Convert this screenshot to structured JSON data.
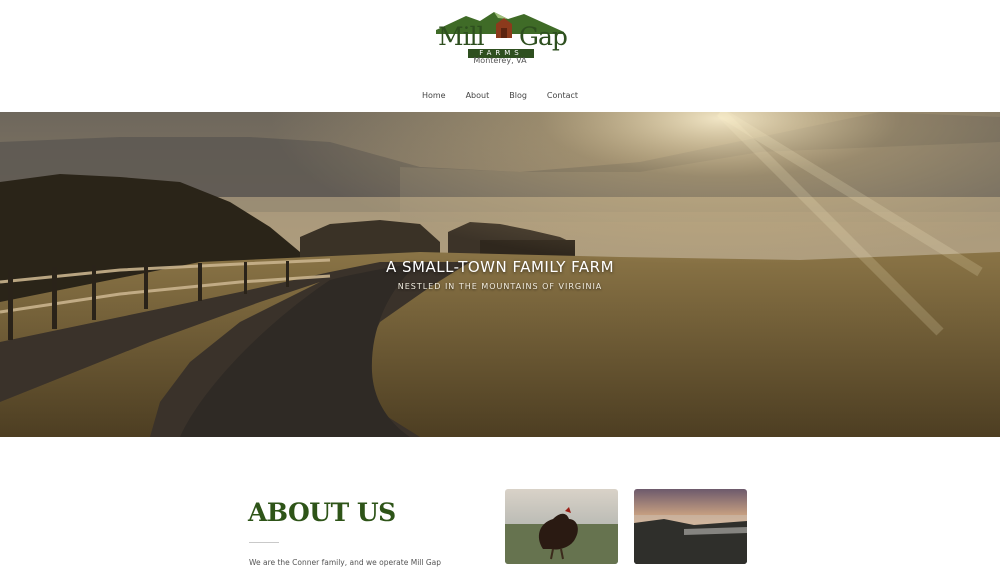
{
  "header": {
    "logo_word_left": "Mill",
    "logo_word_right": "Gap",
    "logo_farms": "FARMS",
    "location": "Monterey, VA"
  },
  "nav": {
    "items": [
      {
        "label": "Home"
      },
      {
        "label": "About"
      },
      {
        "label": "Blog"
      },
      {
        "label": "Contact"
      }
    ]
  },
  "hero": {
    "title": "A SMALL-TOWN FAMILY FARM",
    "subtitle": "NESTLED IN THE MOUNTAINS OF VIRGINIA"
  },
  "about": {
    "heading": "ABOUT US",
    "text": "We are the Conner family, and we operate Mill Gap"
  },
  "colors": {
    "brand_green": "#2e5418",
    "heading_green": "#2e5418"
  },
  "icons": {
    "logo_mountain": "mountain-icon",
    "logo_house": "farmhouse-icon"
  }
}
